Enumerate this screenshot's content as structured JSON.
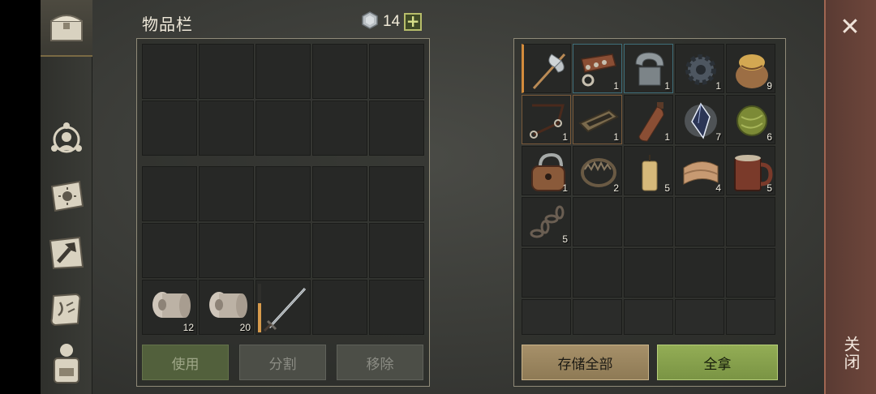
{
  "inventory": {
    "title": "物品栏",
    "currency_count": "14",
    "add_label": "+",
    "slots_row5": [
      {
        "icon": "cloth-roll-icon",
        "count": "12"
      },
      {
        "icon": "cloth-roll-icon",
        "count": "20"
      },
      {
        "icon": "sword-icon",
        "count": "",
        "durability": 0.6
      }
    ],
    "buttons": {
      "use": "使用",
      "split": "分割",
      "remove": "移除"
    }
  },
  "storage": {
    "items": [
      {
        "icon": "halberd-axe-icon",
        "count": "",
        "durability": 0.9
      },
      {
        "icon": "leather-collar-icon",
        "count": "1"
      },
      {
        "icon": "horseshoe-bracket-icon",
        "count": "1"
      },
      {
        "icon": "gear-icon",
        "count": "1"
      },
      {
        "icon": "grain-sack-icon",
        "count": "9"
      },
      {
        "icon": "harness-rope-icon",
        "count": "1"
      },
      {
        "icon": "wooden-frame-icon",
        "count": "1"
      },
      {
        "icon": "leather-flask-icon",
        "count": "1"
      },
      {
        "icon": "crystal-icon",
        "count": "7"
      },
      {
        "icon": "herb-bundle-icon",
        "count": "6"
      },
      {
        "icon": "padlock-icon",
        "count": "1"
      },
      {
        "icon": "bear-trap-icon",
        "count": "2"
      },
      {
        "icon": "candle-icon",
        "count": "5"
      },
      {
        "icon": "folded-leather-icon",
        "count": "4"
      },
      {
        "icon": "wooden-mug-icon",
        "count": "5"
      },
      {
        "icon": "chain-icon",
        "count": "5"
      }
    ],
    "buttons": {
      "store_all": "存储全部",
      "take_all": "全拿"
    }
  },
  "close": {
    "x": "✕",
    "label": "关闭"
  },
  "colors": {
    "accent_green": "#8fa650",
    "accent_tan": "#a69069",
    "close_strip": "#6e463b"
  }
}
